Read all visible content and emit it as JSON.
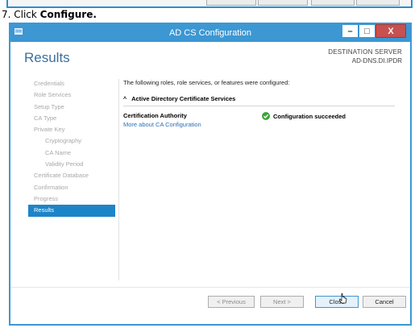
{
  "instruction": {
    "step": "7. Click ",
    "bold": "Configure."
  },
  "window": {
    "title": "AD CS Configuration",
    "controls": {
      "minimize": "–",
      "maximize": "□",
      "close": "X"
    }
  },
  "header": {
    "title": "Results",
    "destination_label": "DESTINATION SERVER",
    "destination_value": "AD-DNS.DI.IPDR"
  },
  "nav": {
    "items": [
      {
        "label": "Credentials",
        "sub": false,
        "active": false
      },
      {
        "label": "Role Services",
        "sub": false,
        "active": false
      },
      {
        "label": "Setup Type",
        "sub": false,
        "active": false
      },
      {
        "label": "CA Type",
        "sub": false,
        "active": false
      },
      {
        "label": "Private Key",
        "sub": false,
        "active": false
      },
      {
        "label": "Cryptography",
        "sub": true,
        "active": false
      },
      {
        "label": "CA Name",
        "sub": true,
        "active": false
      },
      {
        "label": "Validity Period",
        "sub": true,
        "active": false
      },
      {
        "label": "Certificate Database",
        "sub": false,
        "active": false
      },
      {
        "label": "Confirmation",
        "sub": false,
        "active": false
      },
      {
        "label": "Progress",
        "sub": false,
        "active": false
      },
      {
        "label": "Results",
        "sub": false,
        "active": true
      }
    ]
  },
  "content": {
    "intro": "The following roles, role services, or features were configured:",
    "section_title": "Active Directory Certificate Services",
    "item_name": "Certification Authority",
    "item_link": "More about CA Configuration",
    "status": "Configuration succeeded"
  },
  "footer": {
    "previous": "< Previous",
    "next": "Next >",
    "close": "Close",
    "cancel": "Cancel"
  },
  "colors": {
    "titlebar": "#3c97d3",
    "active_nav": "#1e84c8",
    "link": "#2a6fb5",
    "success": "#3aa53a"
  }
}
